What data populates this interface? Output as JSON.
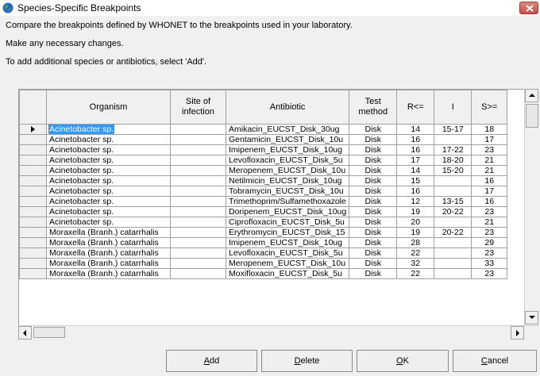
{
  "window": {
    "title": "Species-Specific Breakpoints"
  },
  "instructions": [
    "Compare the breakpoints defined by WHONET to the breakpoints used in your laboratory.",
    "Make any necessary changes.",
    "To add additional species or antibiotics, select 'Add'."
  ],
  "grid": {
    "columns": {
      "organism": "Organism",
      "site_line1": "Site of",
      "site_line2": "infection",
      "antibiotic": "Antibiotic",
      "method_line1": "Test",
      "method_line2": "method",
      "r": "R<=",
      "i": "I",
      "s": "S>="
    },
    "rows": [
      {
        "organism": "Acinetobacter sp.",
        "site": "",
        "antibiotic": "Amikacin_EUCST_Disk_30ug",
        "method": "Disk",
        "r": "14",
        "i": "15-17",
        "s": "18"
      },
      {
        "organism": "Acinetobacter sp.",
        "site": "",
        "antibiotic": "Gentamicin_EUCST_Disk_10u",
        "method": "Disk",
        "r": "16",
        "i": "",
        "s": "17"
      },
      {
        "organism": "Acinetobacter sp.",
        "site": "",
        "antibiotic": "Imipenem_EUCST_Disk_10ug",
        "method": "Disk",
        "r": "16",
        "i": "17-22",
        "s": "23"
      },
      {
        "organism": "Acinetobacter sp.",
        "site": "",
        "antibiotic": "Levofloxacin_EUCST_Disk_5u",
        "method": "Disk",
        "r": "17",
        "i": "18-20",
        "s": "21"
      },
      {
        "organism": "Acinetobacter sp.",
        "site": "",
        "antibiotic": "Meropenem_EUCST_Disk_10u",
        "method": "Disk",
        "r": "14",
        "i": "15-20",
        "s": "21"
      },
      {
        "organism": "Acinetobacter sp.",
        "site": "",
        "antibiotic": "Netilmicin_EUCST_Disk_10ug",
        "method": "Disk",
        "r": "15",
        "i": "",
        "s": "16"
      },
      {
        "organism": "Acinetobacter sp.",
        "site": "",
        "antibiotic": "Tobramycin_EUCST_Disk_10u",
        "method": "Disk",
        "r": "16",
        "i": "",
        "s": "17"
      },
      {
        "organism": "Acinetobacter sp.",
        "site": "",
        "antibiotic": "Trimethoprim/Sulfamethoxazole",
        "method": "Disk",
        "r": "12",
        "i": "13-15",
        "s": "16"
      },
      {
        "organism": "Acinetobacter sp.",
        "site": "",
        "antibiotic": "Doripenem_EUCST_Disk_10ug",
        "method": "Disk",
        "r": "19",
        "i": "20-22",
        "s": "23"
      },
      {
        "organism": "Acinetobacter sp.",
        "site": "",
        "antibiotic": "Ciprofloxacin_EUCST_Disk_5u",
        "method": "Disk",
        "r": "20",
        "i": "",
        "s": "21"
      },
      {
        "organism": "Moraxella (Branh.) catarrhalis",
        "site": "",
        "antibiotic": "Erythromycin_EUCST_Disk_15",
        "method": "Disk",
        "r": "19",
        "i": "20-22",
        "s": "23"
      },
      {
        "organism": "Moraxella (Branh.) catarrhalis",
        "site": "",
        "antibiotic": "Imipenem_EUCST_Disk_10ug",
        "method": "Disk",
        "r": "28",
        "i": "",
        "s": "29"
      },
      {
        "organism": "Moraxella (Branh.) catarrhalis",
        "site": "",
        "antibiotic": "Levofloxacin_EUCST_Disk_5u",
        "method": "Disk",
        "r": "22",
        "i": "",
        "s": "23"
      },
      {
        "organism": "Moraxella (Branh.) catarrhalis",
        "site": "",
        "antibiotic": "Meropenem_EUCST_Disk_10u",
        "method": "Disk",
        "r": "32",
        "i": "",
        "s": "33"
      },
      {
        "organism": "Moraxella (Branh.) catarrhalis",
        "site": "",
        "antibiotic": "Moxifloxacin_EUCST_Disk_5u",
        "method": "Disk",
        "r": "22",
        "i": "",
        "s": "23"
      }
    ]
  },
  "buttons": {
    "add": {
      "pre": "",
      "key": "A",
      "post": "dd"
    },
    "delete": {
      "pre": "",
      "key": "D",
      "post": "elete"
    },
    "ok": {
      "pre": "",
      "key": "O",
      "post": "K"
    },
    "cancel": {
      "pre": "",
      "key": "C",
      "post": "ancel"
    }
  },
  "icons": {
    "title": "globe-icon",
    "close": "close-icon"
  },
  "colors": {
    "selection": "#3399ff",
    "close_button": "#c75050"
  }
}
